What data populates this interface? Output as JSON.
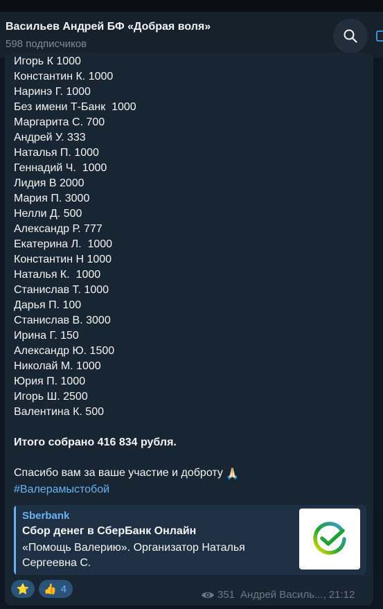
{
  "header": {
    "title": "Васильев Андрей БФ «Добрая воля»",
    "subscribers": "598 подписчиков"
  },
  "message": {
    "donors": [
      "Игорь К 1000",
      "Константин К. 1000",
      "Наринэ Г. 1000",
      "Без имени Т-Банк  1000",
      "Маргарита С. 700",
      "Андрей У. 333",
      "Наталья П. 1000",
      "Геннадий Ч.  1000",
      "Лидия В 2000",
      "Мария П. 3000",
      "Нелли Д. 500",
      "Александр Р. 777",
      "Екатерина Л.  1000",
      "Константин Н 1000",
      "Наталья К.  1000",
      "Станислав Т. 1000",
      "Дарья П. 100",
      "Станислав В. 3000",
      "Ирина Г. 150",
      "Александр Ю. 1500",
      "Николай М. 1000",
      "Юрия П. 1000",
      "Игорь Ш. 2500",
      "Валентина К. 500"
    ],
    "total": "Итого собрано 416 834 рубля.",
    "thanks": "Спасибо вам за ваше участие и доброту",
    "thanks_emoji": "🙏🏻",
    "hashtag": "#Валерамыстобой"
  },
  "link_preview": {
    "site": "Sberbank",
    "title": "Сбор денег в СберБанк Онлайн",
    "description": "«Помощь Валерию». Организатор Наталья Сергеевна С.",
    "thumb_icon": "sberbank-logo"
  },
  "reactions": [
    {
      "emoji": "⭐",
      "count": ""
    },
    {
      "emoji": "👍",
      "count": "4"
    }
  ],
  "meta": {
    "views": "351",
    "author": "Андрей Василь...,",
    "time": "21:12"
  },
  "colors": {
    "background": "#0e1621",
    "header": "#17212b",
    "bubble": "#182533",
    "accent": "#6ab3f3",
    "muted": "#6c7883"
  }
}
